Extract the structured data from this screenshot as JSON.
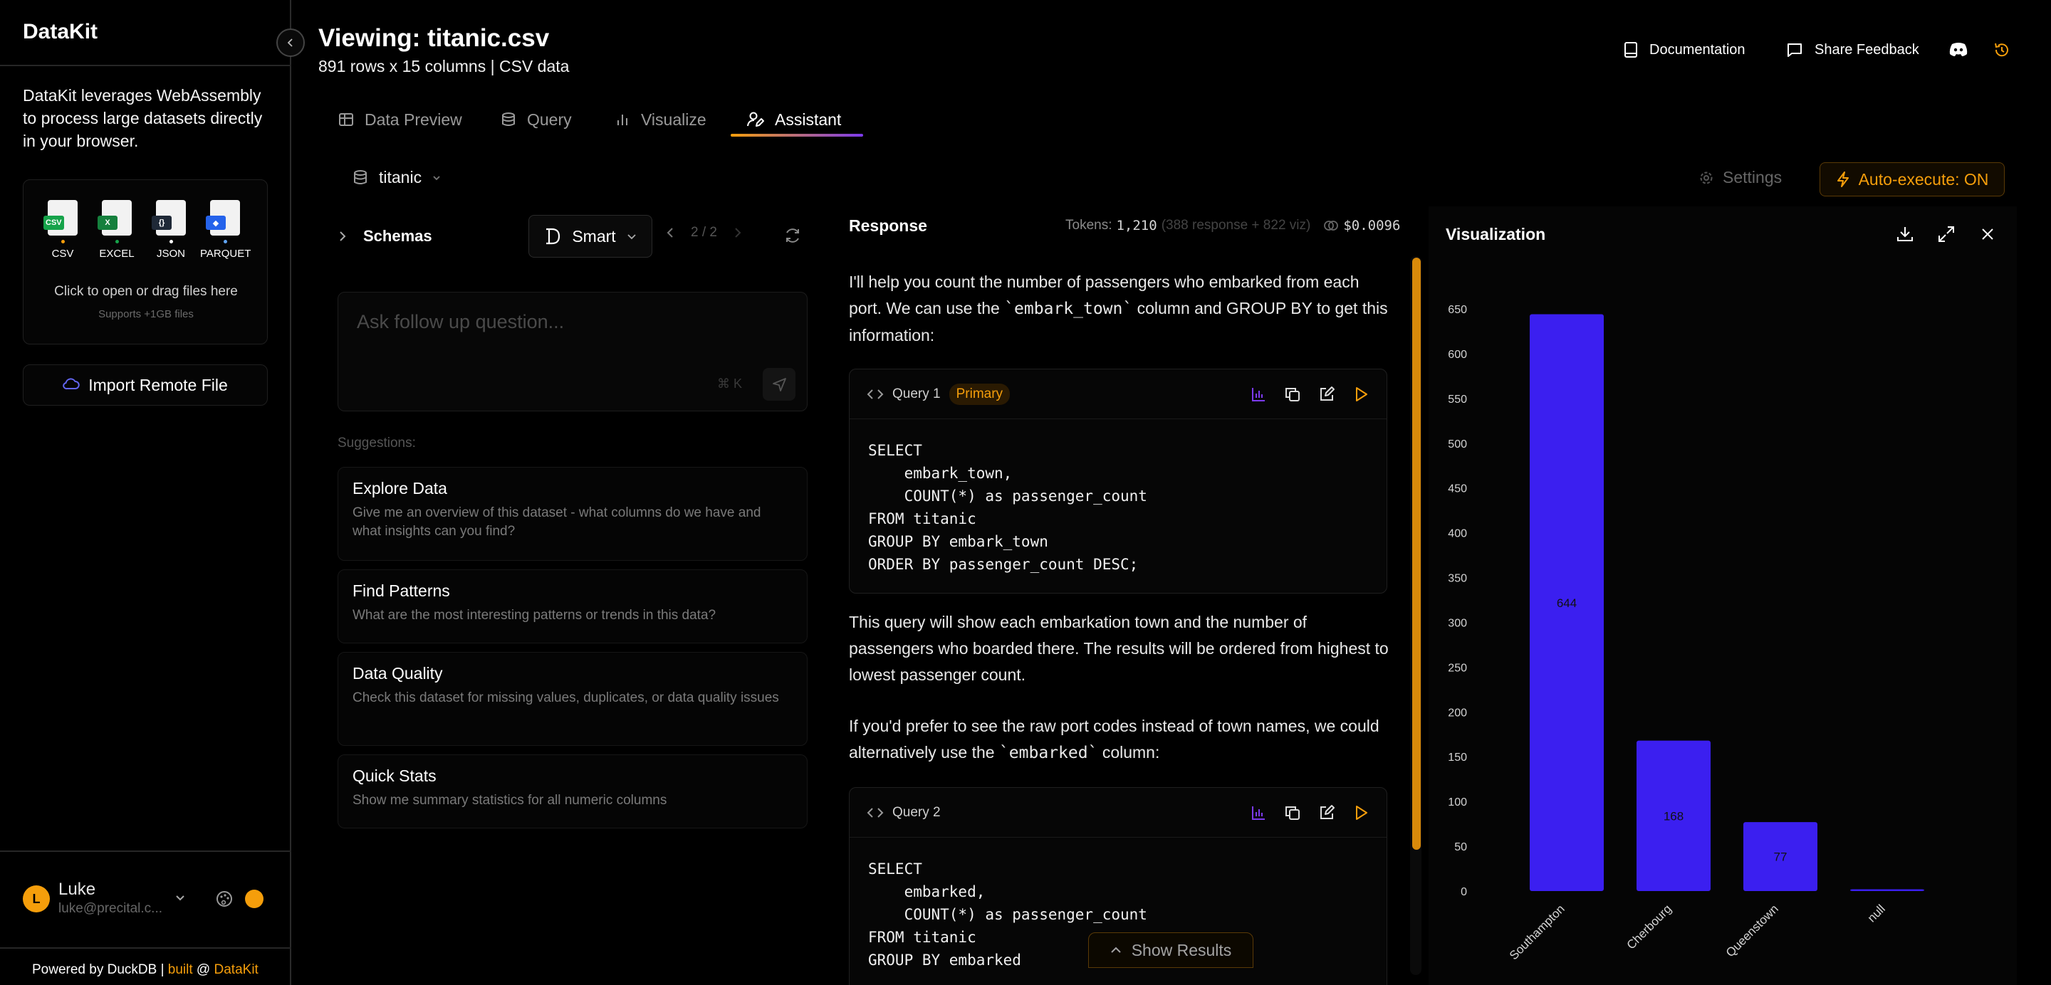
{
  "sidebar": {
    "brand": "DataKit",
    "intro": "DataKit leverages WebAssembly to process large datasets directly in your browser.",
    "file_types": [
      {
        "label": "CSV",
        "tag": "CSV",
        "tag_color": "#16a34a",
        "dot_color": "#f59e0b"
      },
      {
        "label": "EXCEL",
        "tag": "X",
        "tag_color": "#15803d",
        "dot_color": "#16a34a"
      },
      {
        "label": "JSON",
        "tag": "{}",
        "tag_color": "#1f2937",
        "dot_color": "#ffffff"
      },
      {
        "label": "PARQUET",
        "tag": "◆",
        "tag_color": "#2563eb",
        "dot_color": "#60a5fa"
      }
    ],
    "drop_text": "Click to open or drag files here",
    "drop_sub": "Supports +1GB files",
    "import_label": "Import Remote File",
    "user": {
      "initial": "L",
      "name": "Luke",
      "email": "luke@precital.c..."
    },
    "powered_prefix": "Powered by DuckDB | ",
    "powered_built": "built",
    "powered_at": " @ ",
    "powered_brand": "DataKit"
  },
  "header": {
    "title": "Viewing: titanic.csv",
    "subtitle": "891 rows x 15 columns | CSV data",
    "documentation": "Documentation",
    "share_feedback": "Share Feedback"
  },
  "tabs": [
    {
      "label": "Data Preview"
    },
    {
      "label": "Query"
    },
    {
      "label": "Visualize"
    },
    {
      "label": "Assistant",
      "active": true
    }
  ],
  "toolbar": {
    "database": "titanic",
    "settings": "Settings",
    "auto_execute": "Auto-execute: ON"
  },
  "assistant": {
    "schemas_label": "Schemas",
    "mode": "Smart",
    "page": "2 / 2",
    "ask_placeholder": "Ask follow up question...",
    "shortcut": "⌘ K",
    "suggestions_label": "Suggestions:",
    "suggestions": [
      {
        "title": "Explore Data",
        "desc": "Give me an overview of this dataset - what columns do we have and what insights can you find?"
      },
      {
        "title": "Find Patterns",
        "desc": "What are the most interesting patterns or trends in this data?"
      },
      {
        "title": "Data Quality",
        "desc": "Check this dataset for missing values, duplicates, or data quality issues"
      },
      {
        "title": "Quick Stats",
        "desc": "Show me summary statistics for all numeric columns"
      }
    ]
  },
  "response": {
    "heading": "Response",
    "tokens_label": "Tokens:",
    "tokens_total": "1,210",
    "tokens_detail": "(388 response + 822 viz)",
    "cost": "$0.0096",
    "para1_a": "I'll help you count the number of passengers who embarked from each port. We can use the ",
    "para1_code": "`embark_town`",
    "para1_b": " column and GROUP BY to get this information:",
    "query1": {
      "label": "Query 1",
      "badge": "Primary",
      "sql": "SELECT\n    embark_town,\n    COUNT(*) as passenger_count\nFROM titanic\nGROUP BY embark_town\nORDER BY passenger_count DESC;"
    },
    "para2": "This query will show each embarkation town and the number of passengers who boarded there. The results will be ordered from highest to lowest passenger count.",
    "para3_a": "If you'd prefer to see the raw port codes instead of town names, we could alternatively use the ",
    "para3_code": "`embarked`",
    "para3_b": " column:",
    "query2": {
      "label": "Query 2",
      "sql": "SELECT\n    embarked,\n    COUNT(*) as passenger_count\nFROM titanic\nGROUP BY embarked"
    },
    "show_results": "Show Results"
  },
  "visualization": {
    "title": "Visualization"
  },
  "colors": {
    "accent": "#f59e0b",
    "bar": "#3b1ff0",
    "purple": "#7c3aed"
  },
  "chart_data": {
    "type": "bar",
    "categories": [
      "Southampton",
      "Cherbourg",
      "Queenstown",
      "null"
    ],
    "values": [
      644,
      168,
      77,
      2
    ],
    "data_labels": [
      "644",
      "168",
      "77",
      ""
    ],
    "ylim": [
      0,
      650
    ],
    "yticks": [
      0,
      50,
      100,
      150,
      200,
      250,
      300,
      350,
      400,
      450,
      500,
      550,
      600,
      650
    ],
    "grid": false,
    "legend": "none"
  }
}
